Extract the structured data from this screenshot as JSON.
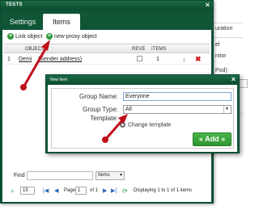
{
  "background_page": {
    "rows": [
      "uration",
      "el",
      "nitor",
      "Pod)",
      "g"
    ]
  },
  "dialog": {
    "title": "TESTS",
    "close_glyph": "×",
    "tabs": [
      {
        "label": "Settings"
      },
      {
        "label": "Items"
      }
    ]
  },
  "toolbar": {
    "link_object": "Link object",
    "new_proxy_object": "new proxy object"
  },
  "table": {
    "columns": [
      "OBJECTS",
      "REVE",
      "ITEMS"
    ],
    "rows": [
      {
        "index": "1",
        "name": "Demi",
        "detail": "(Sender address)",
        "items": "1"
      }
    ]
  },
  "find": {
    "label": "Find",
    "scope": "Items"
  },
  "pager": {
    "page_size": "15",
    "page_label": "Page",
    "page": "1",
    "of_label": "of 1",
    "status": "Displaying 1 to 1 of 1 items"
  },
  "new_item": {
    "title": "New Item",
    "close_glyph": "×",
    "group_name_label": "Group Name:",
    "group_name_value": "Everyone",
    "group_type_label": "Group Type:",
    "group_type_value": "All",
    "template_label": "Template:",
    "change_template": "Change template",
    "add_button": "« Add »"
  },
  "colors": {
    "header_green": "#0f5536",
    "arrow_red": "#c0101a",
    "add_green": "#3aa63a"
  }
}
